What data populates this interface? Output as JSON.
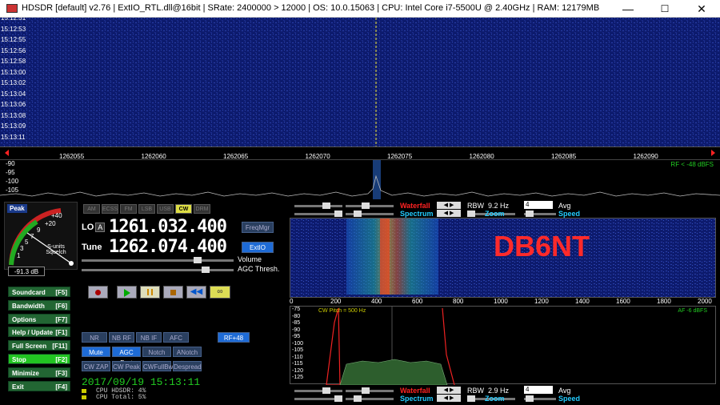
{
  "window": {
    "title": "HDSDR  [default]  v2.76   |  ExtIO_RTL.dll@16bit  |  SRate: 2400000 > 12000  |  OS: 10.0.15063   |  CPU: Intel Core i7-5500U @ 2.40GHz  |  RAM: 12179MB",
    "min": "—",
    "max": "☐",
    "close": "✕"
  },
  "waterfall": {
    "timestamps": [
      "15:12:51",
      "15:12:53",
      "15:12:55",
      "15:12:56",
      "15:12:58",
      "15:13:00",
      "15:13:02",
      "15:13:04",
      "15:13:06",
      "15:13:08",
      "15:13:09",
      "15:13:11"
    ]
  },
  "freq_scale": [
    "1262055",
    "1262060",
    "1262065",
    "1262070",
    "1262075",
    "1262080",
    "1262085",
    "1262090"
  ],
  "spectrum": {
    "db_labels": [
      "-90",
      "-95",
      "-100",
      "-105"
    ],
    "rf_note": "RF < -48 dBFS"
  },
  "meter": {
    "peak": "Peak",
    "marks": [
      "+40",
      "+20",
      "9",
      "7",
      "5",
      "3",
      "1"
    ],
    "smeter": "S-units Squelch",
    "value": "-91.3 dB"
  },
  "modes": [
    "AM",
    "ECSS",
    "FM",
    "LSB",
    "USB",
    "CW",
    "DRM"
  ],
  "lo": {
    "label": "LO",
    "a": "A",
    "value": "1261.032.400",
    "btn": "FreqMgr"
  },
  "tune": {
    "label": "Tune",
    "value": "1262.074.400",
    "btn": "ExtIO"
  },
  "sliders": {
    "volume": "Volume",
    "agc": "AGC Thresh."
  },
  "left_buttons": [
    {
      "label": "Soundcard",
      "key": "[F5]"
    },
    {
      "label": "Bandwidth",
      "key": "[F6]"
    },
    {
      "label": "Options",
      "key": "[F7]"
    },
    {
      "label": "Help / Update",
      "key": "[F1]"
    },
    {
      "label": "Full Screen",
      "key": "[F11]"
    },
    {
      "label": "Stop",
      "key": "[F2]"
    },
    {
      "label": "Minimize",
      "key": "[F3]"
    },
    {
      "label": "Exit",
      "key": "[F4]"
    }
  ],
  "dsp1": [
    "NR",
    "NB RF",
    "NB IF",
    "AFC",
    "RF+48"
  ],
  "dsp2": [
    "Mute",
    "AGC Fast",
    "Notch",
    "ANotch"
  ],
  "dsp3": [
    "CW ZAP",
    "CW Peak",
    "CWFullBw",
    "Despread"
  ],
  "datetime": "2017/09/19 15:13:11",
  "cpu": {
    "hdsdr": "CPU HDSDR:  4%",
    "total": "CPU Total:  5%"
  },
  "rp_top": {
    "waterfall": "Waterfall",
    "spectrum": "Spectrum",
    "rbw": "RBW",
    "rbw_val": "9.2 Hz",
    "zoom": "Zoom",
    "avg": "Avg",
    "avg_val": "4",
    "speed": "Speed"
  },
  "rp_bottom": {
    "waterfall": "Waterfall",
    "spectrum": "Spectrum",
    "rbw": "RBW",
    "rbw_val": "2.9 Hz",
    "zoom": "Zoom",
    "avg": "Avg",
    "avg_val": "4",
    "speed": "Speed"
  },
  "callsign": "DB6NT",
  "af_scale": [
    "0",
    "200",
    "400",
    "600",
    "800",
    "1000",
    "1200",
    "1400",
    "1600",
    "1800",
    "2000"
  ],
  "af": {
    "cw_pitch": "CW Pitch = 500 Hz",
    "note": "AF  -6 dBFS",
    "db": [
      "-75",
      "-80",
      "-85",
      "-90",
      "-95",
      "-100",
      "-105",
      "-110",
      "-115",
      "-120",
      "-125"
    ]
  },
  "colors": {
    "waterfall": "#0d1b6e",
    "accent": "#ff2a2a",
    "green": "#22cc22",
    "button": "#226633"
  }
}
